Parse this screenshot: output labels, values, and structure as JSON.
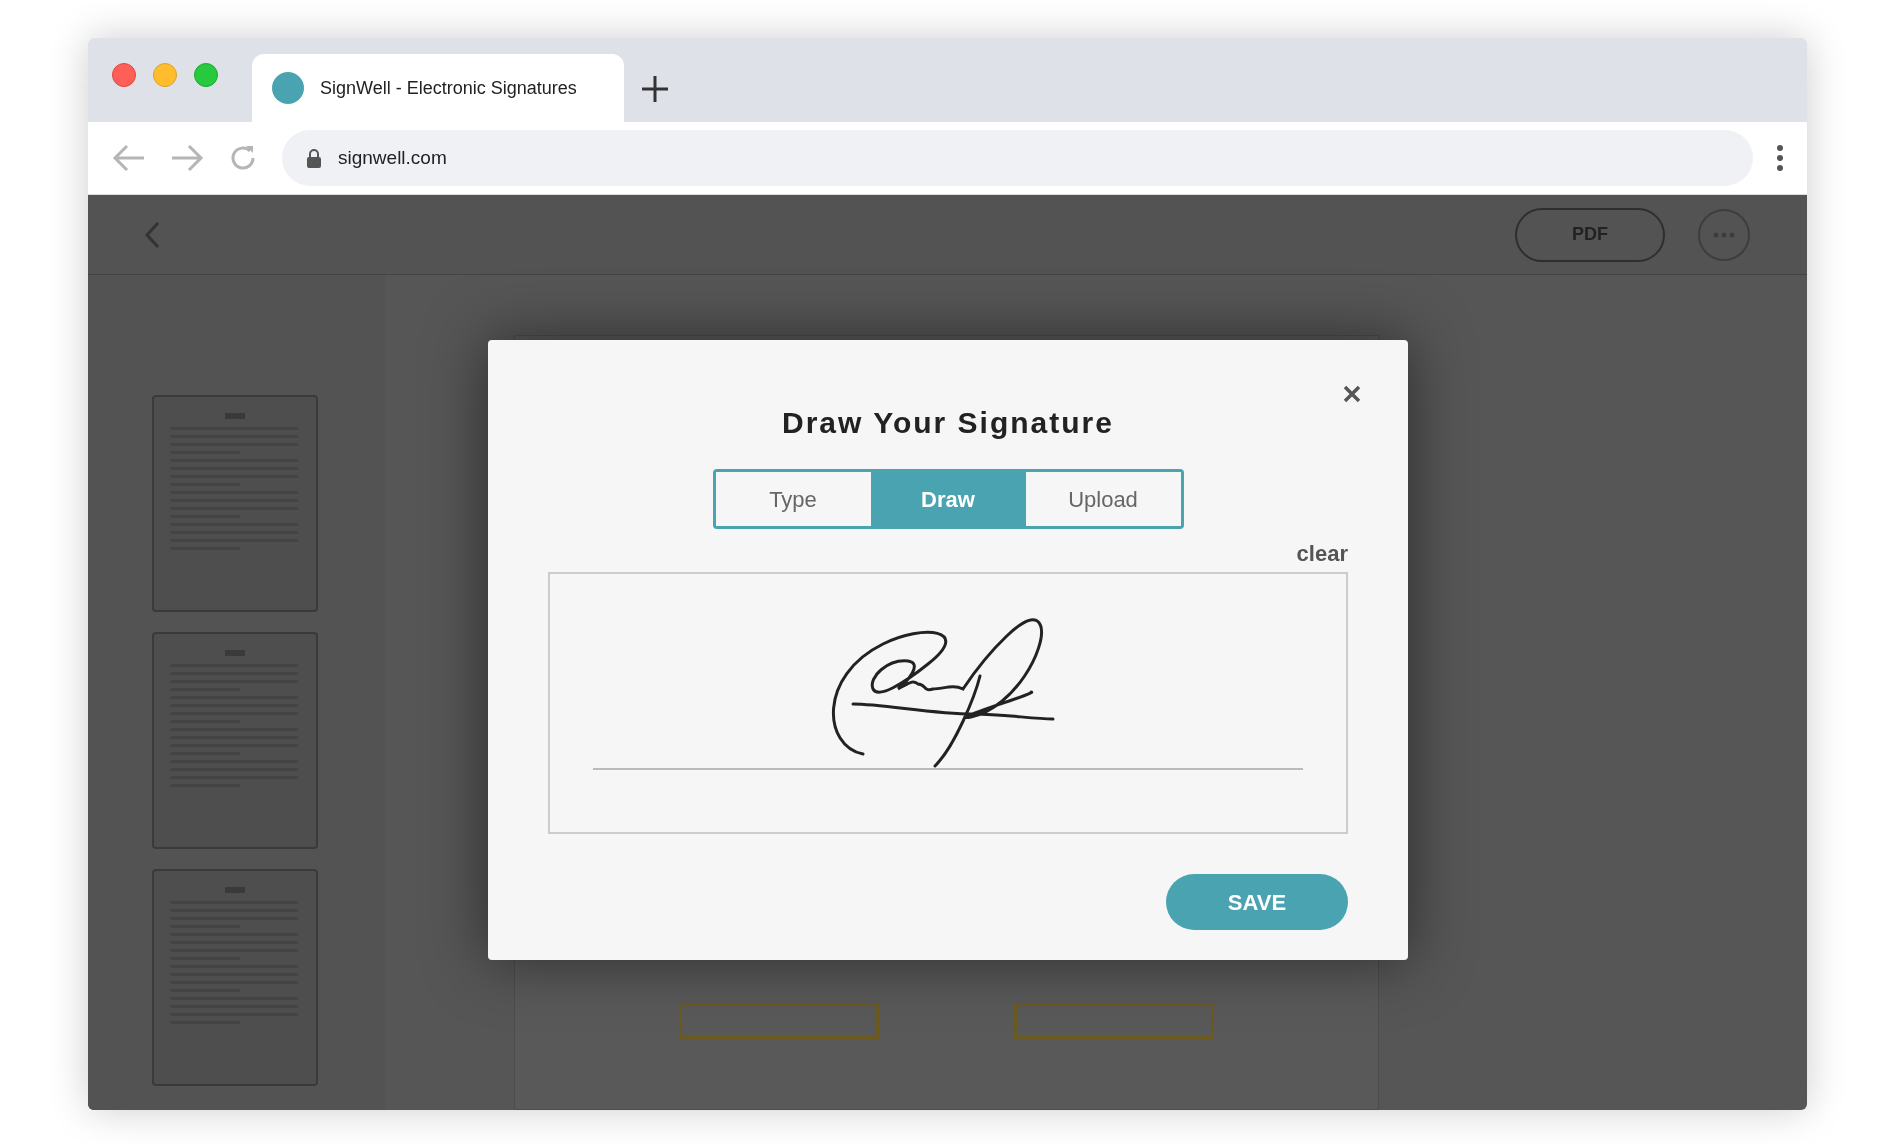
{
  "browser": {
    "tab_title": "SignWell - Electronic Signatures",
    "url": "signwell.com"
  },
  "toolbar": {
    "pdf_button": "PDF"
  },
  "modal": {
    "title": "Draw Your Signature",
    "tabs": [
      {
        "label": "Type",
        "selected": false
      },
      {
        "label": "Draw",
        "selected": true
      },
      {
        "label": "Upload",
        "selected": false
      }
    ],
    "clear": "clear",
    "save": "SAVE"
  }
}
